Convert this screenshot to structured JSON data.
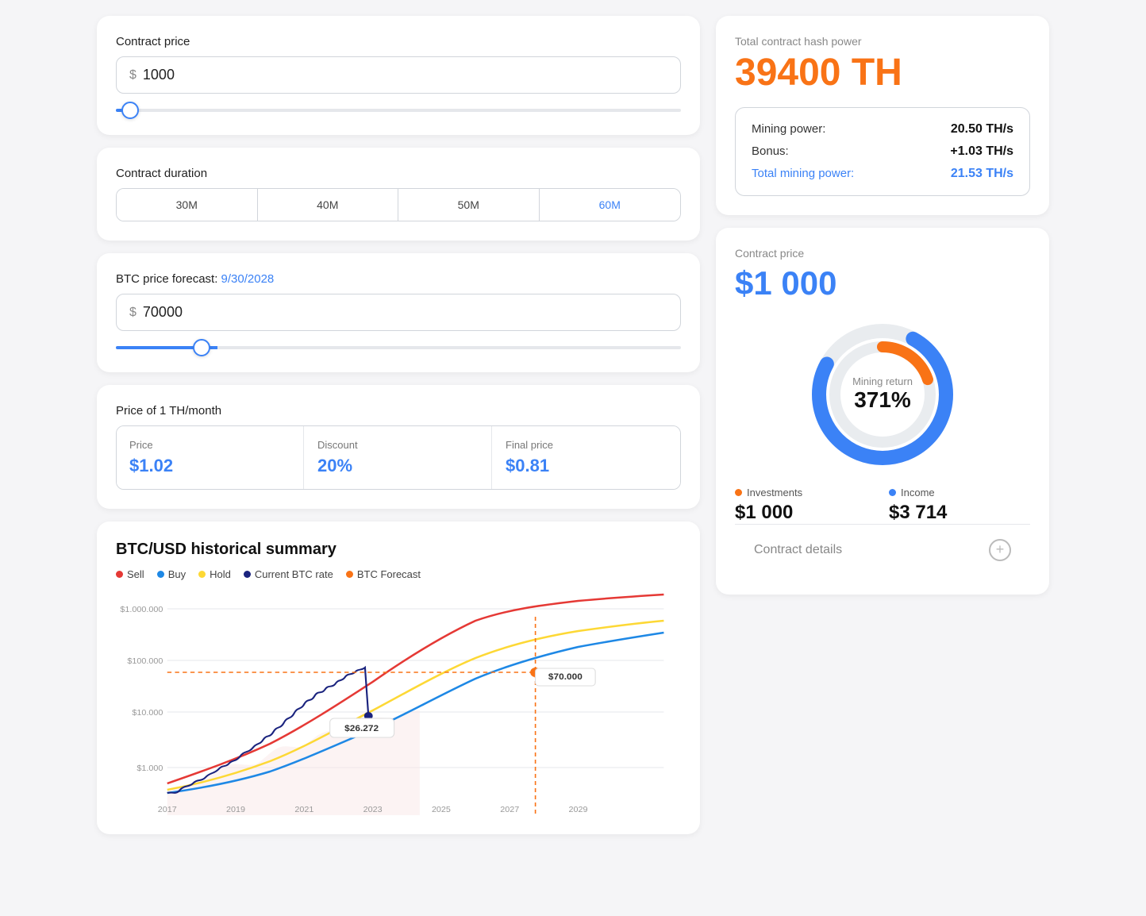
{
  "left": {
    "contract_price_label": "Contract price",
    "contract_price_value": "1000",
    "dollar_sign": "$",
    "contract_duration_label": "Contract duration",
    "duration_options": [
      "30M",
      "40M",
      "50M",
      "60M"
    ],
    "duration_active": "60M",
    "btc_forecast_label": "BTC price forecast:",
    "btc_forecast_date": "9/30/2028",
    "btc_price_value": "70000",
    "th_month_label": "Price of 1 TH/month",
    "price_label": "Price",
    "price_value": "$1.02",
    "discount_label": "Discount",
    "discount_value": "20%",
    "final_price_label": "Final price",
    "final_price_value": "$0.81",
    "chart_title": "BTC/USD historical summary",
    "legend": [
      {
        "label": "Sell",
        "color": "#e53935"
      },
      {
        "label": "Buy",
        "color": "#1e88e5"
      },
      {
        "label": "Hold",
        "color": "#fdd835"
      },
      {
        "label": "Current BTC rate",
        "color": "#1a237e"
      },
      {
        "label": "BTC Forecast",
        "color": "#f97316"
      }
    ],
    "chart_x_labels": [
      "2017",
      "2019",
      "2021",
      "2023",
      "2025",
      "2027",
      "2029"
    ],
    "chart_y_labels": [
      "$1.000.000",
      "$100.000",
      "$10.000",
      "$1.000"
    ],
    "price_callout": "$26.272",
    "forecast_callout": "$70.000"
  },
  "right": {
    "total_hash_label": "Total contract hash power",
    "total_hash_value": "39400 TH",
    "mining_power_label": "Mining power:",
    "mining_power_value": "20.50 TH/s",
    "bonus_label": "Bonus:",
    "bonus_value": "+1.03 TH/s",
    "total_mining_label": "Total mining power:",
    "total_mining_value": "21.53 TH/s",
    "contract_price_label": "Contract price",
    "contract_price_value": "$1 000",
    "donut_label": "Mining return",
    "donut_value": "371%",
    "investments_label": "Investments",
    "investments_value": "$1 000",
    "income_label": "Income",
    "income_value": "$3 714",
    "contract_details_label": "Contract details",
    "plus_icon": "+"
  }
}
